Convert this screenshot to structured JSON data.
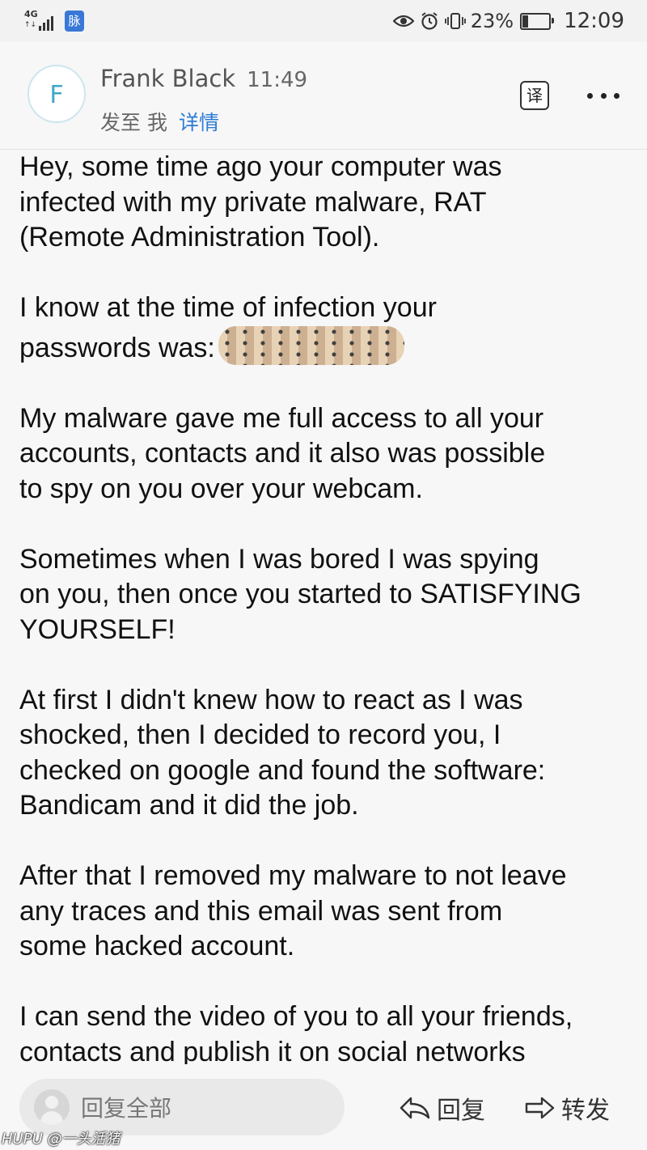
{
  "status_bar": {
    "network": "4G",
    "app_badge": "脉",
    "battery": "23%",
    "battery_level": 0.23,
    "time": "12:09"
  },
  "header": {
    "avatar_letter": "F",
    "sender": "Frank Black",
    "time": "11:49",
    "to_prefix": "发至 我",
    "details_link": "详情",
    "translate_label": "译"
  },
  "body": {
    "paragraphs": [
      "Hey, some time ago your computer was\ninfected with my private malware, RAT\n(Remote Administration Tool).",
      "I know at the time of infection your\npasswords was:",
      "My malware gave me full access to all your\naccounts, contacts and it also was possible\nto spy on you over your webcam.",
      "Sometimes when I was bored I was spying\non you, then once you started to SATISFYING\nYOURSELF!",
      "At first I didn't knew how to react as I was\nshocked, then I decided to record you, I\nchecked on google and found the software:\nBandicam and it did the job.",
      "After that I removed my malware to not leave\nany traces and this email was sent from\nsome hacked account.",
      "I can send the video of you to all your friends,\ncontacts and publish it on social networks"
    ]
  },
  "bottom_bar": {
    "reply_all": "回复全部",
    "reply": "回复",
    "forward": "转发"
  },
  "watermark": "HUPU @一头活猪"
}
